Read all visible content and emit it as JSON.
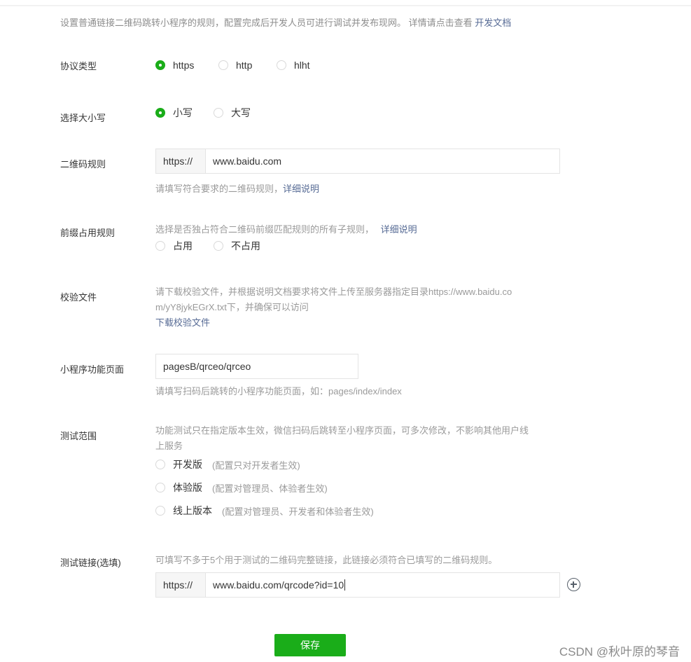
{
  "intro": {
    "text": "设置普通链接二维码跳转小程序的规则，配置完成后开发人员可进行调试并发布现网。 详情请点击查看",
    "link": "开发文档"
  },
  "protocol": {
    "label": "协议类型",
    "options": [
      {
        "label": "https",
        "selected": true
      },
      {
        "label": "http",
        "selected": false
      },
      {
        "label": "hlht",
        "selected": false
      }
    ]
  },
  "case": {
    "label": "选择大小写",
    "options": [
      {
        "label": "小写",
        "selected": true
      },
      {
        "label": "大写",
        "selected": false
      }
    ]
  },
  "qr_rule": {
    "label": "二维码规则",
    "prefix": "https://",
    "value": "www.baidu.com",
    "hint": "请填写符合要求的二维码规则，",
    "hint_link": "详细说明"
  },
  "prefix_rule": {
    "label": "前缀占用规则",
    "hint": "选择是否独占符合二维码前缀匹配规则的所有子规则，",
    "hint_link": "详细说明",
    "options": [
      {
        "label": "占用",
        "selected": false
      },
      {
        "label": "不占用",
        "selected": false
      }
    ]
  },
  "verify_file": {
    "label": "校验文件",
    "desc_line1": "请下载校验文件，并根据说明文档要求将文件上传至服务器指定目录https://www.baidu.co",
    "desc_line2": "m/yY8jykEGrX.txt下，并确保可以访问",
    "download_link": "下载校验文件"
  },
  "page": {
    "label": "小程序功能页面",
    "value": "pagesB/qrceo/qrceo",
    "hint": "请填写扫码后跳转的小程序功能页面，如：pages/index/index"
  },
  "test_scope": {
    "label": "测试范围",
    "desc_line1": "功能测试只在指定版本生效，微信扫码后跳转至小程序页面，可多次修改，不影响其他用户线",
    "desc_line2": "上服务",
    "options": [
      {
        "label": "开发版",
        "note": "(配置只对开发者生效)",
        "selected": false
      },
      {
        "label": "体验版",
        "note": "(配置对管理员、体验者生效)",
        "selected": false
      },
      {
        "label": "线上版本",
        "note": "(配置对管理员、开发者和体验者生效)",
        "selected": false
      }
    ]
  },
  "test_link": {
    "label": "测试链接(选填)",
    "hint": "可填写不多于5个用于测试的二维码完整链接，此链接必须符合已填写的二维码规则。",
    "prefix": "https://",
    "value": "www.baidu.com/qrcode?id=10"
  },
  "save_label": "保存",
  "watermark": "CSDN @秋叶原的琴音",
  "colors": {
    "accent": "#1aad19",
    "link": "#576b95"
  }
}
